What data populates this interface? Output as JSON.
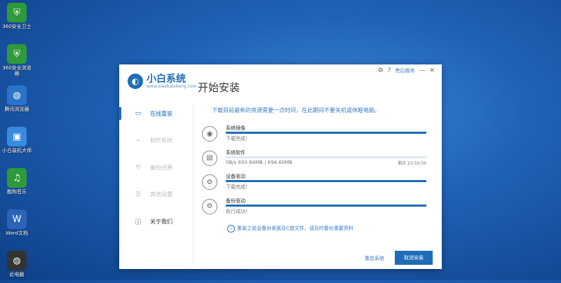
{
  "desktop": {
    "icons": [
      {
        "icon": "shield-icon",
        "label": "360安全卫士",
        "color": "#2e9a3a"
      },
      {
        "icon": "shield-icon",
        "label": "360安全浏览器",
        "color": "#2e9a3a"
      },
      {
        "icon": "globe-icon",
        "label": "腾讯浏览器",
        "color": "#2a73c8"
      },
      {
        "icon": "app-icon",
        "label": "小白装机大师",
        "color": "#3a8be0"
      },
      {
        "icon": "music-icon",
        "label": "酷狗音乐",
        "color": "#2e9a3a"
      },
      {
        "icon": "document-icon",
        "label": "Word文档",
        "color": "#2a63b8"
      },
      {
        "icon": "globe-icon",
        "label": "此电脑",
        "color": "#333333"
      }
    ]
  },
  "window": {
    "brand": "小白系统",
    "brand_url": "www.xiaobaixitong.com",
    "title": "开始安装",
    "controls": {
      "feedback": "售后服务",
      "minimize": "—",
      "close": "✕"
    }
  },
  "sidebar": {
    "items": [
      {
        "label": "在线重装",
        "icon": "monitor-icon",
        "active": true
      },
      {
        "label": "制作系统",
        "icon": "usb-icon",
        "active": false
      },
      {
        "label": "备份还原",
        "icon": "backup-icon",
        "active": false
      },
      {
        "label": "其他设置",
        "icon": "settings-icon",
        "active": false
      },
      {
        "label": "关于我们",
        "icon": "info-icon",
        "active": false
      }
    ]
  },
  "content": {
    "notice": "下载目前最新的资源需要一点时间，在此期间不要关机或休眠电脑。",
    "tasks": [
      {
        "name": "系统镜像",
        "status": "下载完成！",
        "right": "",
        "icon": "disc-icon",
        "progress": 1.0
      },
      {
        "name": "系统软件",
        "status": "0B/s 693.64MB | 694.60MB",
        "right": "剩余 23:59:59",
        "icon": "folder-icon",
        "progress": 0.0
      },
      {
        "name": "设备驱动",
        "status": "下载完成！",
        "right": "",
        "icon": "gear-icon",
        "progress": 1.0
      },
      {
        "name": "备份驱动",
        "status": "执行成功！",
        "right": "",
        "icon": "gear-icon",
        "progress": 1.0
      }
    ],
    "tip": "重装之前会备份桌面及C盘文件，请及时备份重要资料",
    "buttons": {
      "skip": "重启系统",
      "cancel": "取消安装"
    }
  }
}
